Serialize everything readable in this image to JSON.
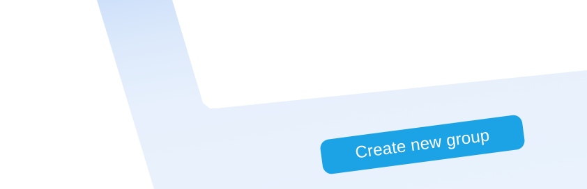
{
  "actions": {
    "create_group_label": "Create new group"
  },
  "colors": {
    "primary_button": "#1ba3e6",
    "panel_background": "#e9f2fd",
    "panel_gradient_top": "#c9ddf9",
    "card_background": "#ffffff"
  }
}
